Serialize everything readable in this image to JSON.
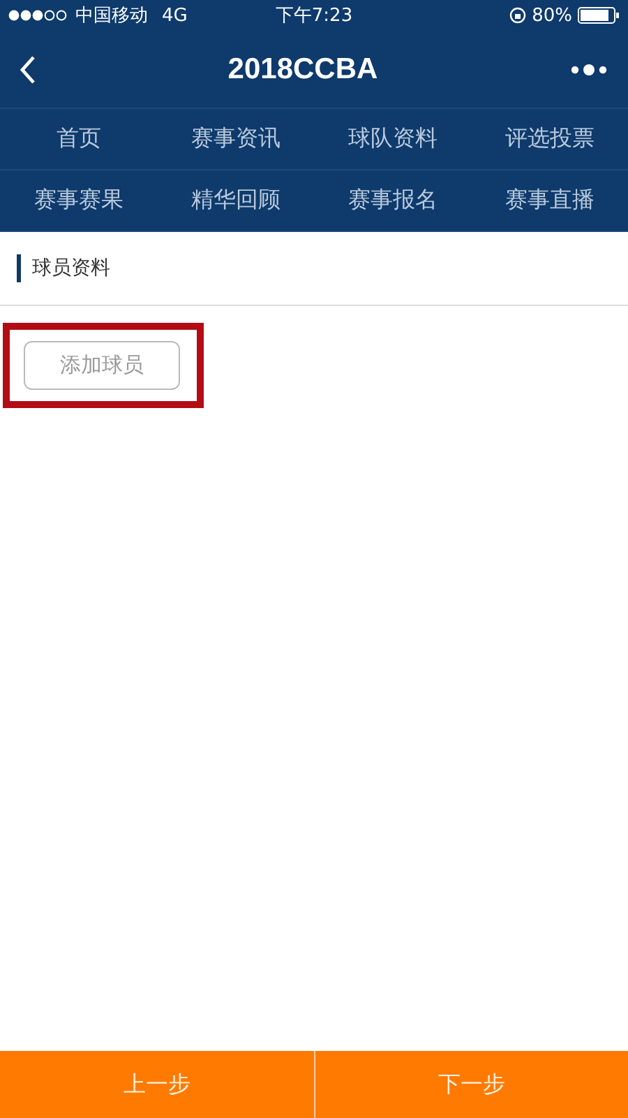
{
  "status_bar": {
    "carrier": "中国移动",
    "network": "4G",
    "time": "下午7:23",
    "battery": "80%"
  },
  "nav_bar": {
    "title": "2018CCBA"
  },
  "menu": [
    {
      "label": "首页"
    },
    {
      "label": "赛事资讯"
    },
    {
      "label": "球队资料"
    },
    {
      "label": "评选投票"
    },
    {
      "label": "赛事赛果"
    },
    {
      "label": "精华回顾"
    },
    {
      "label": "赛事报名"
    },
    {
      "label": "赛事直播"
    }
  ],
  "section": {
    "title": "球员资料"
  },
  "add_button": {
    "label": "添加球员",
    "highlighted": true
  },
  "footer": {
    "buttons": [
      "上一步",
      "下一步"
    ]
  }
}
